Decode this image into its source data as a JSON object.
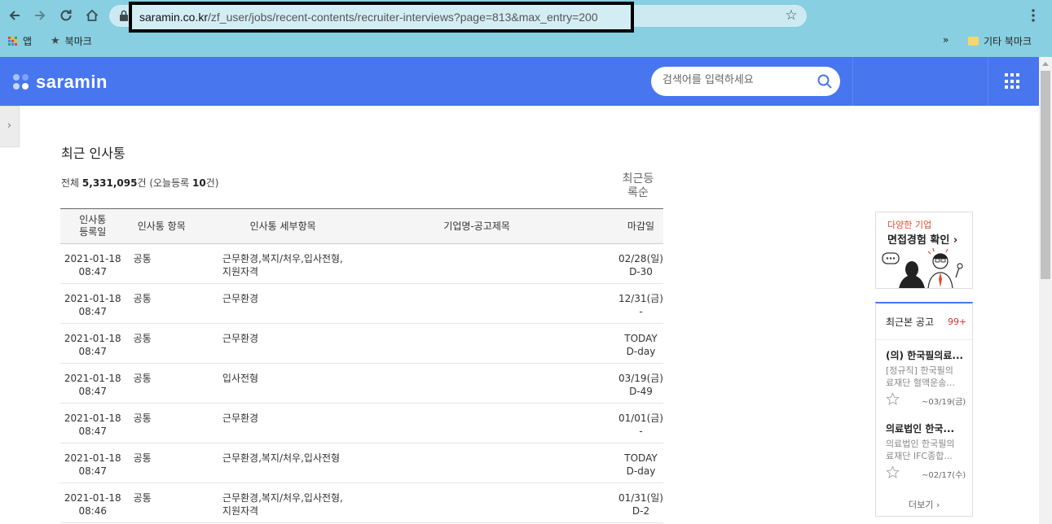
{
  "browser": {
    "url_host": "saramin.co.kr",
    "url_path": "/zf_user/jobs/recent-contents/recruiter-interviews?page=813&max_entry=200",
    "bookmarks": {
      "apps_label": "앱",
      "bookmark_label": "북마크",
      "overflow_label": "»",
      "other_label": "기타 북마크"
    }
  },
  "site": {
    "logo_text": "saramin",
    "brand_color": "#4876ef",
    "search_placeholder": "검색어를 입력하세요"
  },
  "side_tab": {
    "label": "›"
  },
  "main": {
    "title": "최근 인사통",
    "total_prefix": "전체 ",
    "total_count": "5,331,095",
    "total_unit": "건 (오늘등록 ",
    "today_count": "10",
    "today_unit": "건)",
    "sort_line1": "최근등",
    "sort_line2": "록순",
    "columns": {
      "date_line1": "인사통",
      "date_line2": "등록일",
      "type": "인사통 항목",
      "detail": "인사통 세부항목",
      "company": "기업명-공고제목",
      "deadline": "마감일"
    },
    "rows": [
      {
        "date": "2021-01-18",
        "time": "08:47",
        "type": "공통",
        "detail1": "근무환경,복지/처우,입사전형,",
        "detail2": "지원자격",
        "company": "",
        "deadline": "02/28(일)",
        "dday": "D-30"
      },
      {
        "date": "2021-01-18",
        "time": "08:47",
        "type": "공통",
        "detail1": "근무환경",
        "detail2": "",
        "company": "",
        "deadline": "12/31(금)",
        "dday": "-"
      },
      {
        "date": "2021-01-18",
        "time": "08:47",
        "type": "공통",
        "detail1": "근무환경",
        "detail2": "",
        "company": "",
        "deadline": "TODAY",
        "dday": "D-day"
      },
      {
        "date": "2021-01-18",
        "time": "08:47",
        "type": "공통",
        "detail1": "입사전형",
        "detail2": "",
        "company": "",
        "deadline": "03/19(금)",
        "dday": "D-49"
      },
      {
        "date": "2021-01-18",
        "time": "08:47",
        "type": "공통",
        "detail1": "근무환경",
        "detail2": "",
        "company": "",
        "deadline": "01/01(금)",
        "dday": "-"
      },
      {
        "date": "2021-01-18",
        "time": "08:47",
        "type": "공통",
        "detail1": "근무환경,복지/처우,입사전형",
        "detail2": "",
        "company": "",
        "deadline": "TODAY",
        "dday": "D-day"
      },
      {
        "date": "2021-01-18",
        "time": "08:46",
        "type": "공통",
        "detail1": "근무환경,복지/처우,입사전형,",
        "detail2": "지원자격",
        "company": "",
        "deadline": "01/31(일)",
        "dday": "D-2"
      }
    ]
  },
  "ad": {
    "subtitle": "다양한 기업",
    "title": "면접경험 확인",
    "arrow": "›"
  },
  "recent": {
    "title": "최근본 공고",
    "count": "99+",
    "jobs": [
      {
        "name": "(의) 한국필의료...",
        "desc1": "[정규직] 한국필의",
        "desc2": "료재단 혈액운송...",
        "date": "~03/19(금)"
      },
      {
        "name": "의료법인 한국...",
        "desc1": "의료법인 한국필의",
        "desc2": "료재단 IFC종합...",
        "date": "~02/17(수)"
      }
    ],
    "more": "더보기 ›"
  }
}
